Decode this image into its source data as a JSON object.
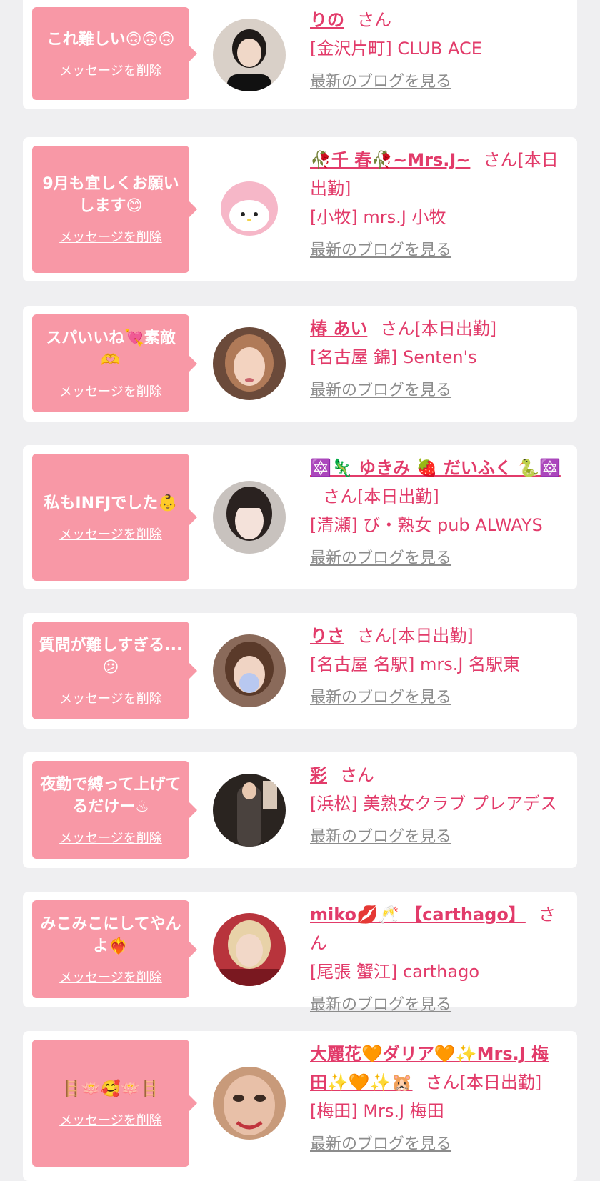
{
  "common": {
    "delete_label": "メッセージを削除",
    "blog_label": "最新のブログを見る",
    "san_label": "さん"
  },
  "cards": [
    {
      "message": "これ難しい🙃🙃🙃",
      "name": "りの",
      "status": "",
      "shop": "[金沢片町] CLUB ACE"
    },
    {
      "message": "9月も宜しくお願いします😊",
      "name": "🥀千 春🥀~Mrs.J~",
      "status": "[本日出勤]",
      "shop": "[小牧] mrs.J 小牧"
    },
    {
      "message": "スパいいね💘素敵🫶",
      "name": "椿 あい",
      "status": "[本日出勤]",
      "shop": "[名古屋 錦] Senten's"
    },
    {
      "message": "私もINFJでした👶",
      "name": "🔯🦎 ゆきみ 🍓 だいふく 🐍🔯",
      "status": "[本日出勤]",
      "shop": "[清瀬] び・熟女 pub ALWAYS"
    },
    {
      "message": "質問が難しすぎる...😕",
      "name": "りさ",
      "status": "[本日出勤]",
      "shop": "[名古屋 名駅] mrs.J 名駅東"
    },
    {
      "message": "夜勤で縛って上げてるだけー♨",
      "name": "彩",
      "status": "",
      "shop": "[浜松] 美熟女クラブ プレアデス"
    },
    {
      "message": "みこみこにしてやんよ❤️‍🔥",
      "name": "miko💋🥂 【carthago】",
      "status": "",
      "shop": "[尾張 蟹江] carthago"
    },
    {
      "message": "🪜🪷🥰🪷🪜",
      "name": "大麗花🧡ダリア🧡✨Mrs.J 梅田✨🧡✨🐹",
      "status": "[本日出勤]",
      "shop": "[梅田] Mrs.J 梅田"
    }
  ],
  "colors": {
    "background": "#efeff1",
    "card": "#ffffff",
    "bubble": "#f898a6",
    "accent": "#e23b6a",
    "link_gray": "#8c8c8c"
  }
}
